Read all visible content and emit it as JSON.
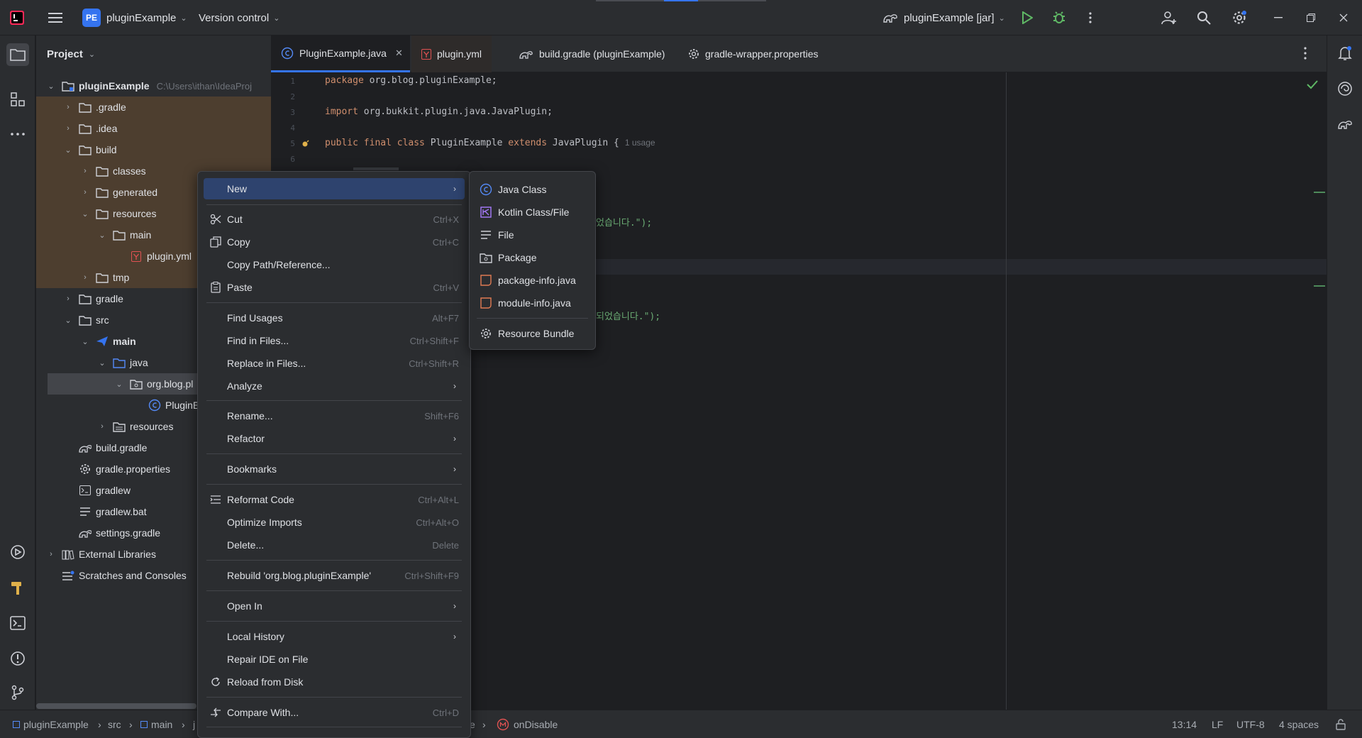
{
  "titlebar": {
    "project_badge": "PE",
    "project_name": "pluginExample",
    "vcs": "Version control",
    "run_config": "pluginExample [jar]"
  },
  "project_panel": {
    "title": "Project",
    "root_path": "C:\\Users\\ithan\\IdeaProj",
    "items": [
      {
        "label": "pluginExample"
      },
      {
        "label": ".gradle"
      },
      {
        "label": ".idea"
      },
      {
        "label": "build"
      },
      {
        "label": "classes"
      },
      {
        "label": "generated"
      },
      {
        "label": "resources"
      },
      {
        "label": "main"
      },
      {
        "label": "plugin.yml"
      },
      {
        "label": "tmp"
      },
      {
        "label": "gradle"
      },
      {
        "label": "src"
      },
      {
        "label": "main"
      },
      {
        "label": "java"
      },
      {
        "label": "org.blog.pl"
      },
      {
        "label": "PluginE"
      },
      {
        "label": "resources"
      },
      {
        "label": "build.gradle"
      },
      {
        "label": "gradle.properties"
      },
      {
        "label": "gradlew"
      },
      {
        "label": "gradlew.bat"
      },
      {
        "label": "settings.gradle"
      },
      {
        "label": "External Libraries"
      },
      {
        "label": "Scratches and Consoles"
      }
    ]
  },
  "tabs": [
    {
      "label": "PluginExample.java"
    },
    {
      "label": "plugin.yml"
    },
    {
      "label": "build.gradle (pluginExample)"
    },
    {
      "label": "gradle-wrapper.properties"
    }
  ],
  "editor": {
    "line_numbers": [
      "1",
      "2",
      "3",
      "4",
      "5",
      "6"
    ],
    "line1_kw": "package",
    "line1_rest": " org.blog.pluginExample;",
    "line3_kw": "import",
    "line3_rest": " org.bukkit.plugin.java.JavaPlugin;",
    "line5_kw1": "public final class",
    "line5_mid": " PluginExample ",
    "line5_kw2": "extends",
    "line5_rest": " JavaPlugin {",
    "line5_usage": "1 usage",
    "frag1": "었습니다.\");",
    "frag2": "되었습니다.\");"
  },
  "context_menu": {
    "items": [
      {
        "label": "New",
        "shortcut": ""
      },
      {
        "label": "Cut",
        "shortcut": "Ctrl+X"
      },
      {
        "label": "Copy",
        "shortcut": "Ctrl+C"
      },
      {
        "label": "Copy Path/Reference...",
        "shortcut": ""
      },
      {
        "label": "Paste",
        "shortcut": "Ctrl+V"
      },
      {
        "label": "Find Usages",
        "shortcut": "Alt+F7"
      },
      {
        "label": "Find in Files...",
        "shortcut": "Ctrl+Shift+F"
      },
      {
        "label": "Replace in Files...",
        "shortcut": "Ctrl+Shift+R"
      },
      {
        "label": "Analyze",
        "shortcut": ""
      },
      {
        "label": "Rename...",
        "shortcut": "Shift+F6"
      },
      {
        "label": "Refactor",
        "shortcut": ""
      },
      {
        "label": "Bookmarks",
        "shortcut": ""
      },
      {
        "label": "Reformat Code",
        "shortcut": "Ctrl+Alt+L"
      },
      {
        "label": "Optimize Imports",
        "shortcut": "Ctrl+Alt+O"
      },
      {
        "label": "Delete...",
        "shortcut": "Delete"
      },
      {
        "label": "Rebuild 'org.blog.pluginExample'",
        "shortcut": "Ctrl+Shift+F9"
      },
      {
        "label": "Open In",
        "shortcut": ""
      },
      {
        "label": "Local History",
        "shortcut": ""
      },
      {
        "label": "Repair IDE on File",
        "shortcut": ""
      },
      {
        "label": "Reload from Disk",
        "shortcut": ""
      },
      {
        "label": "Compare With...",
        "shortcut": "Ctrl+D"
      }
    ]
  },
  "submenu": {
    "items": [
      {
        "label": "Java Class"
      },
      {
        "label": "Kotlin Class/File"
      },
      {
        "label": "File"
      },
      {
        "label": "Package"
      },
      {
        "label": "package-info.java"
      },
      {
        "label": "module-info.java"
      },
      {
        "label": "Resource Bundle"
      }
    ]
  },
  "statusbar": {
    "crumbs": [
      "pluginExample",
      "src",
      "main",
      "j"
    ],
    "crumb_tail_e": "e",
    "method": "onDisable",
    "position": "13:14",
    "line_sep": "LF",
    "encoding": "UTF-8",
    "indent": "4 spaces"
  },
  "colors": {
    "accent": "#3574f0",
    "menu_highlight": "#2e436e",
    "excluded_folder_bg": "#4d3e2f",
    "keyword": "#cf8e6d",
    "string": "#6aab73"
  }
}
